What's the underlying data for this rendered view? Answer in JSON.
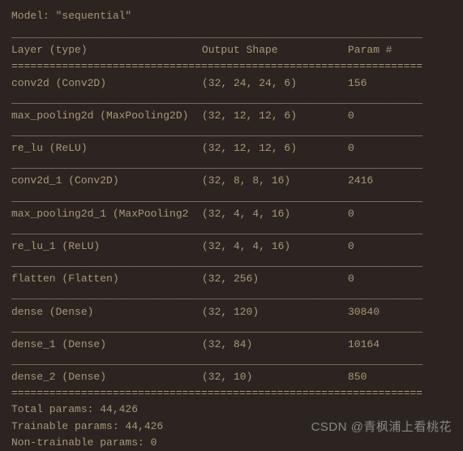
{
  "model_name_line": "Model: \"sequential\"",
  "header": {
    "layer": "Layer (type)",
    "output": "Output Shape",
    "param": "Param #"
  },
  "layers": [
    {
      "name": "conv2d (Conv2D)",
      "output": "(32, 24, 24, 6)",
      "param": "156"
    },
    {
      "name": "max_pooling2d (MaxPooling2D)",
      "output": "(32, 12, 12, 6)",
      "param": "0"
    },
    {
      "name": "re_lu (ReLU)",
      "output": "(32, 12, 12, 6)",
      "param": "0"
    },
    {
      "name": "conv2d_1 (Conv2D)",
      "output": "(32, 8, 8, 16)",
      "param": "2416"
    },
    {
      "name": "max_pooling2d_1 (MaxPooling2",
      "output": "(32, 4, 4, 16)",
      "param": "0"
    },
    {
      "name": "re_lu_1 (ReLU)",
      "output": "(32, 4, 4, 16)",
      "param": "0"
    },
    {
      "name": "flatten (Flatten)",
      "output": "(32, 256)",
      "param": "0"
    },
    {
      "name": "dense (Dense)",
      "output": "(32, 120)",
      "param": "30840"
    },
    {
      "name": "dense_1 (Dense)",
      "output": "(32, 84)",
      "param": "10164"
    },
    {
      "name": "dense_2 (Dense)",
      "output": "(32, 10)",
      "param": "850"
    }
  ],
  "summary": {
    "total": "Total params: 44,426",
    "trainable": "Trainable params: 44,426",
    "non_trainable": "Non-trainable params: 0"
  },
  "divider_eq": "=================================================================",
  "divider_us": "_________________________________________________________________",
  "watermark": "CSDN @青枫浦上看桃花"
}
